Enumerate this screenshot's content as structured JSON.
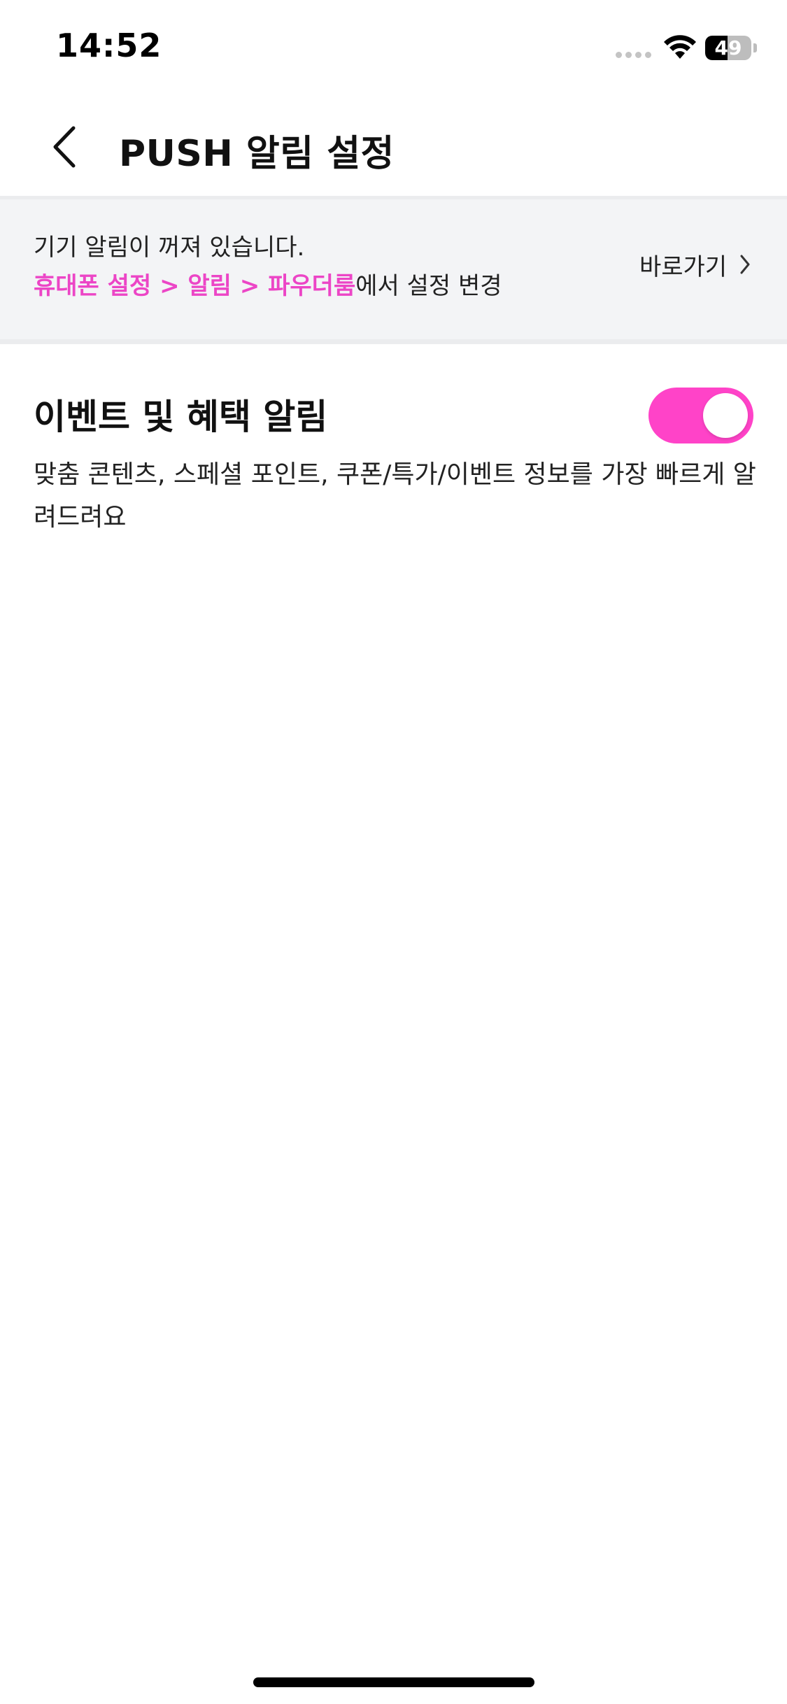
{
  "status_bar": {
    "time": "14:52",
    "battery_level": "49",
    "battery_fraction": 0.49
  },
  "header": {
    "back_icon": "chevron-left-icon",
    "title": "PUSH 알림 설정"
  },
  "notice": {
    "line1": "기기 알림이 꺼져 있습니다.",
    "path_text": "휴대폰 설정 > 알림 > 파우더룸",
    "suffix_text": "에서 설정 변경",
    "shortcut_label": "바로가기",
    "shortcut_icon": "chevron-right-icon",
    "path_color": "#ec45c6"
  },
  "setting": {
    "title": "이벤트 및 혜택 알림",
    "description": "맞춤 콘텐츠, 스페셜 포인트, 쿠폰/특가/이벤트 정보를 가장 빠르게 알려드려요",
    "enabled": true,
    "toggle_color": "#ff43c8"
  }
}
